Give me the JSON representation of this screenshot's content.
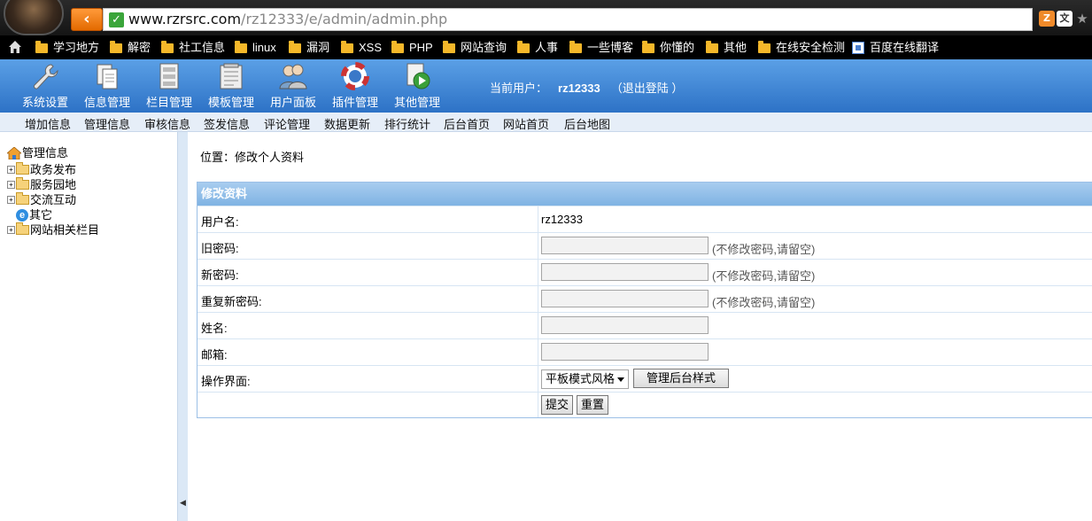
{
  "browser": {
    "url_host": "www.rzrsrc.com",
    "url_path": "/rz12333/e/admin/admin.php"
  },
  "bookmarks": [
    {
      "label": "学习地方"
    },
    {
      "label": "解密"
    },
    {
      "label": "社工信息"
    },
    {
      "label": "linux"
    },
    {
      "label": "漏洞"
    },
    {
      "label": "XSS"
    },
    {
      "label": "PHP"
    },
    {
      "label": "网站查询"
    },
    {
      "label": "人事"
    },
    {
      "label": "一些博客"
    },
    {
      "label": "你懂的"
    },
    {
      "label": "其他"
    },
    {
      "label": "在线安全检测"
    },
    {
      "label": "百度在线翻译"
    }
  ],
  "header": {
    "items": [
      {
        "label": "系统设置",
        "icon": "wrench-icon"
      },
      {
        "label": "信息管理",
        "icon": "documents-icon"
      },
      {
        "label": "栏目管理",
        "icon": "columns-icon"
      },
      {
        "label": "模板管理",
        "icon": "template-icon"
      },
      {
        "label": "用户面板",
        "icon": "users-icon"
      },
      {
        "label": "插件管理",
        "icon": "lifebuoy-icon"
      },
      {
        "label": "其他管理",
        "icon": "play-doc-icon"
      }
    ],
    "current_user_label": "当前用户：",
    "current_user": "rz12333",
    "logout": "（退出登陆 ）"
  },
  "subnav": [
    "增加信息",
    "管理信息",
    "审核信息",
    "签发信息",
    "评论管理",
    "数据更新",
    "排行统计",
    "后台首页",
    "网站首页",
    "后台地图"
  ],
  "tree": {
    "root": "管理信息",
    "items": [
      {
        "label": "政务发布",
        "type": "folder"
      },
      {
        "label": "服务园地",
        "type": "folder"
      },
      {
        "label": "交流互动",
        "type": "folder"
      },
      {
        "label": "其它",
        "type": "link"
      },
      {
        "label": "网站相关栏目",
        "type": "folder"
      }
    ]
  },
  "main": {
    "location": "位置：修改个人资料",
    "form_title": "修改资料",
    "rows": {
      "username_label": "用户名:",
      "username_value": "rz12333",
      "old_pwd_label": "旧密码:",
      "new_pwd_label": "新密码:",
      "repeat_pwd_label": "重复新密码:",
      "pwd_hint": "(不修改密码,请留空)",
      "name_label": "姓名:",
      "email_label": "邮箱:",
      "ui_label": "操作界面:",
      "ui_select": "平板模式风格",
      "style_button": "管理后台样式",
      "submit": "提交",
      "reset": "重置"
    }
  }
}
